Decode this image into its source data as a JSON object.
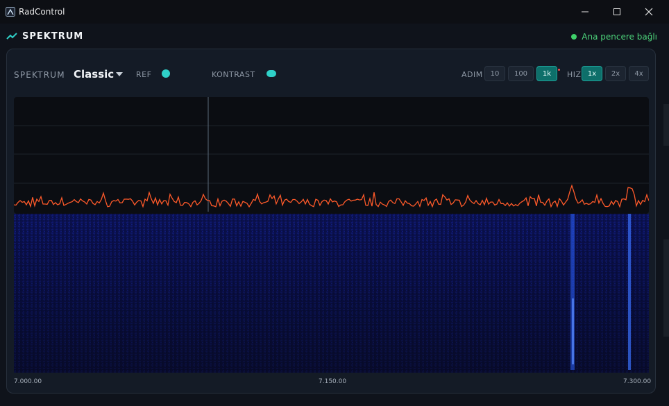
{
  "window": {
    "title": "RadControl"
  },
  "header": {
    "title": "SPEKTRUM",
    "status": "Ana pencere bağlı",
    "status_color": "#3fd06a"
  },
  "toolbar": {
    "spectrum_label": "SPEKTRUM",
    "mode": "Classic",
    "ref_label": "REF",
    "contrast_label": "KONTRAST",
    "step_label": "ADIM",
    "step_options": [
      "10",
      "100",
      "1k"
    ],
    "step_selected": "1k",
    "speed_label": "HIZ",
    "speed_options": [
      "1x",
      "2x",
      "4x"
    ],
    "speed_selected": "1x"
  },
  "frequency_axis": {
    "start": "7.000.00",
    "mid": "7.150.00",
    "end": "7.300.00"
  },
  "colors": {
    "accent": "#2fd1c8",
    "trace": "#ff5a2a",
    "waterfall": "#0c1158",
    "active_button": "#0e6f6a"
  },
  "icons": [
    "app-logo-icon",
    "minimize-icon",
    "maximize-icon",
    "close-icon",
    "trend-icon",
    "chevron-down-icon"
  ]
}
